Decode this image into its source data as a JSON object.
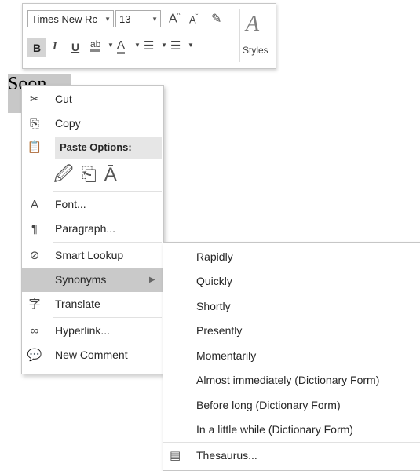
{
  "mini_toolbar": {
    "font_name": "Times New Rc",
    "font_size": "13",
    "grow_font": "A",
    "shrink_font": "A",
    "styles_label": "Styles",
    "bold": "B",
    "italic": "I",
    "underline": "U",
    "highlight": "ab",
    "font_color": "A"
  },
  "document": {
    "selected_text": "Soon"
  },
  "context_menu": {
    "cut": "Cut",
    "copy": "Copy",
    "paste_options": "Paste Options:",
    "font": "Font...",
    "paragraph": "Paragraph...",
    "smart_lookup": "Smart Lookup",
    "synonyms": "Synonyms",
    "translate": "Translate",
    "hyperlink": "Hyperlink...",
    "new_comment": "New Comment"
  },
  "synonyms_submenu": {
    "items": [
      "Rapidly",
      "Quickly",
      "Shortly",
      "Presently",
      "Momentarily",
      "Almost immediately (Dictionary Form)",
      "Before long (Dictionary Form)",
      "In a little while (Dictionary Form)"
    ],
    "thesaurus": "Thesaurus..."
  }
}
